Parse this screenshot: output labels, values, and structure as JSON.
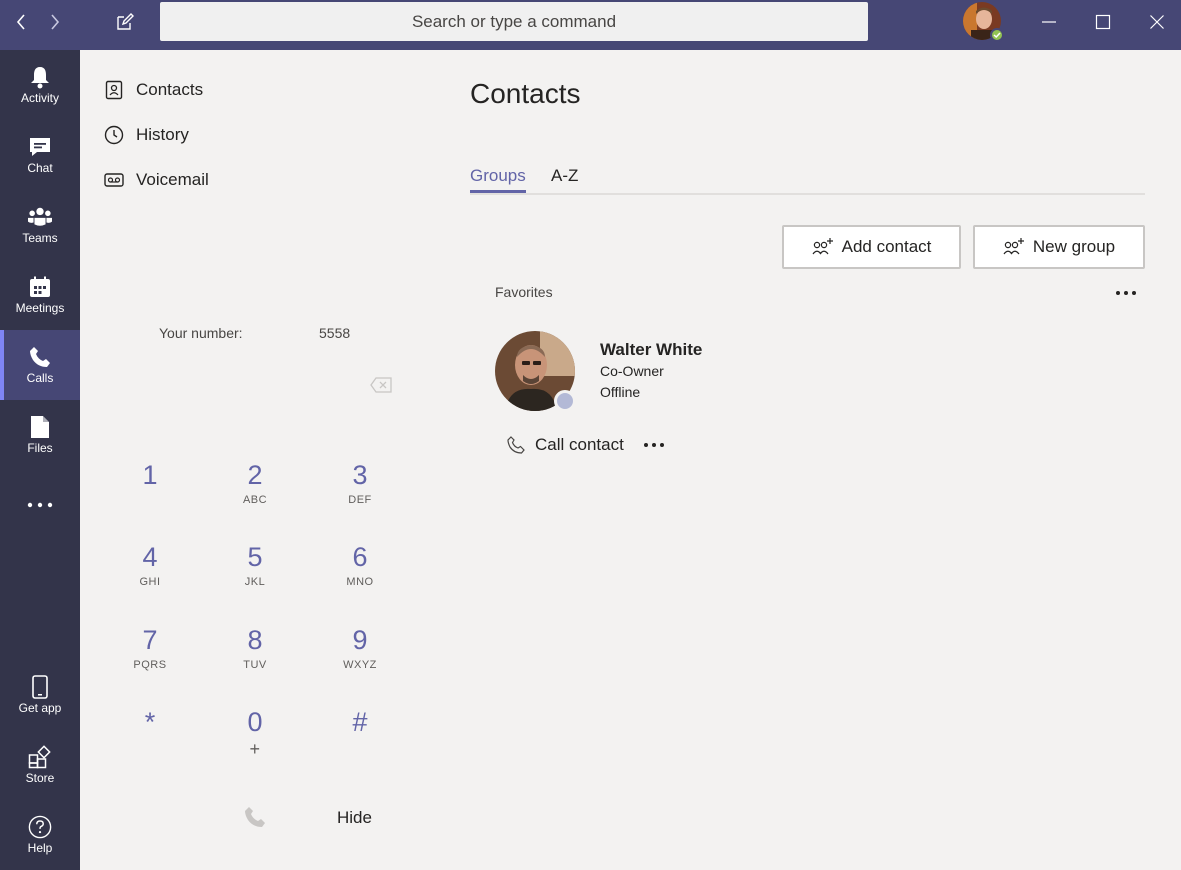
{
  "search": {
    "placeholder": "Search or type a command"
  },
  "rail": {
    "items": [
      {
        "label": "Activity",
        "icon": "bell-icon"
      },
      {
        "label": "Chat",
        "icon": "chat-icon"
      },
      {
        "label": "Teams",
        "icon": "teams-icon"
      },
      {
        "label": "Meetings",
        "icon": "calendar-icon"
      },
      {
        "label": "Calls",
        "icon": "phone-icon"
      },
      {
        "label": "Files",
        "icon": "file-icon"
      },
      {
        "label": "Get app",
        "icon": "mobile-icon"
      },
      {
        "label": "Store",
        "icon": "store-icon"
      },
      {
        "label": "Help",
        "icon": "help-icon"
      }
    ]
  },
  "calls_nav": {
    "items": [
      {
        "label": "Contacts",
        "icon": "contacts-icon"
      },
      {
        "label": "History",
        "icon": "clock-icon"
      },
      {
        "label": "Voicemail",
        "icon": "voicemail-icon"
      }
    ]
  },
  "dialpad": {
    "your_number_label": "Your number:",
    "your_number_value": "5558",
    "keys": [
      {
        "digit": "1",
        "letters": ""
      },
      {
        "digit": "2",
        "letters": "ABC"
      },
      {
        "digit": "3",
        "letters": "DEF"
      },
      {
        "digit": "4",
        "letters": "GHI"
      },
      {
        "digit": "5",
        "letters": "JKL"
      },
      {
        "digit": "6",
        "letters": "MNO"
      },
      {
        "digit": "7",
        "letters": "PQRS"
      },
      {
        "digit": "8",
        "letters": "TUV"
      },
      {
        "digit": "9",
        "letters": "WXYZ"
      },
      {
        "digit": "*",
        "letters": ""
      },
      {
        "digit": "0",
        "letters": "+"
      },
      {
        "digit": "#",
        "letters": ""
      }
    ],
    "hide_label": "Hide"
  },
  "main": {
    "title": "Contacts",
    "tabs": [
      {
        "label": "Groups"
      },
      {
        "label": "A-Z"
      }
    ],
    "add_contact_label": "Add contact",
    "new_group_label": "New group",
    "favorites_label": "Favorites",
    "contact": {
      "name": "Walter White",
      "role": "Co-Owner",
      "status": "Offline",
      "call_label": "Call contact"
    }
  },
  "colors": {
    "titlebar": "#464775",
    "rail": "#33344a",
    "accent": "#6264a7",
    "online": "#92c353",
    "offline": "#b3b9d6"
  }
}
